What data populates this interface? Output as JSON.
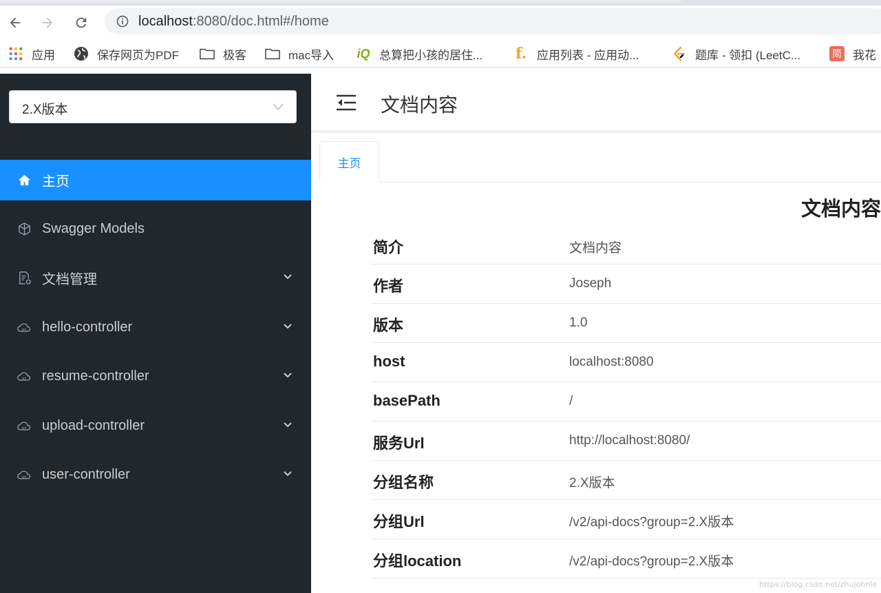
{
  "browser": {
    "url_host": "localhost",
    "url_rest": ":8080/doc.html#/home",
    "bookmarks": [
      {
        "label": "应用",
        "icon": "apps-grid-icon"
      },
      {
        "label": "保存网页为PDF",
        "icon": "globe-icon"
      },
      {
        "label": "极客",
        "icon": "folder-icon"
      },
      {
        "label": "mac导入",
        "icon": "folder-icon"
      },
      {
        "label": "总算把小孩的居住...",
        "icon": "iq-logo-icon"
      },
      {
        "label": "应用列表 - 应用动...",
        "icon": "f-logo-icon"
      },
      {
        "label": "题库 - 领扣 (LeetC...",
        "icon": "leetcode-icon"
      },
      {
        "label": "我花",
        "icon": "jianshu-icon"
      }
    ]
  },
  "sidebar": {
    "version_select": "2.X版本",
    "items": [
      {
        "label": "主页",
        "icon": "home-icon",
        "active": true,
        "expandable": false
      },
      {
        "label": "Swagger Models",
        "icon": "cube-icon",
        "active": false,
        "expandable": false
      },
      {
        "label": "文档管理",
        "icon": "doc-settings-icon",
        "active": false,
        "expandable": true
      },
      {
        "label": "hello-controller",
        "icon": "api-cloud-icon",
        "active": false,
        "expandable": true
      },
      {
        "label": "resume-controller",
        "icon": "api-cloud-icon",
        "active": false,
        "expandable": true
      },
      {
        "label": "upload-controller",
        "icon": "api-cloud-icon",
        "active": false,
        "expandable": true
      },
      {
        "label": "user-controller",
        "icon": "api-cloud-icon",
        "active": false,
        "expandable": true
      }
    ]
  },
  "header": {
    "title": "文档内容"
  },
  "tabs": [
    {
      "label": "主页"
    }
  ],
  "doc": {
    "title": "文档内容",
    "rows": [
      {
        "key": "简介",
        "value": "文档内容"
      },
      {
        "key": "作者",
        "value": "Joseph"
      },
      {
        "key": "版本",
        "value": "1.0"
      },
      {
        "key": "host",
        "value": "localhost:8080"
      },
      {
        "key": "basePath",
        "value": "/"
      },
      {
        "key": "服务Url",
        "value": "http://localhost:8080/"
      },
      {
        "key": "分组名称",
        "value": "2.X版本"
      },
      {
        "key": "分组Url",
        "value": "/v2/api-docs?group=2.X版本"
      },
      {
        "key": "分组location",
        "value": "/v2/api-docs?group=2.X版本"
      }
    ]
  },
  "watermark": "https://blog.csdn.net/zhujohnle",
  "colors": {
    "sidebar_bg": "#20282d",
    "accent": "#1890ff",
    "sidebar_text": "#c8cdd1"
  }
}
